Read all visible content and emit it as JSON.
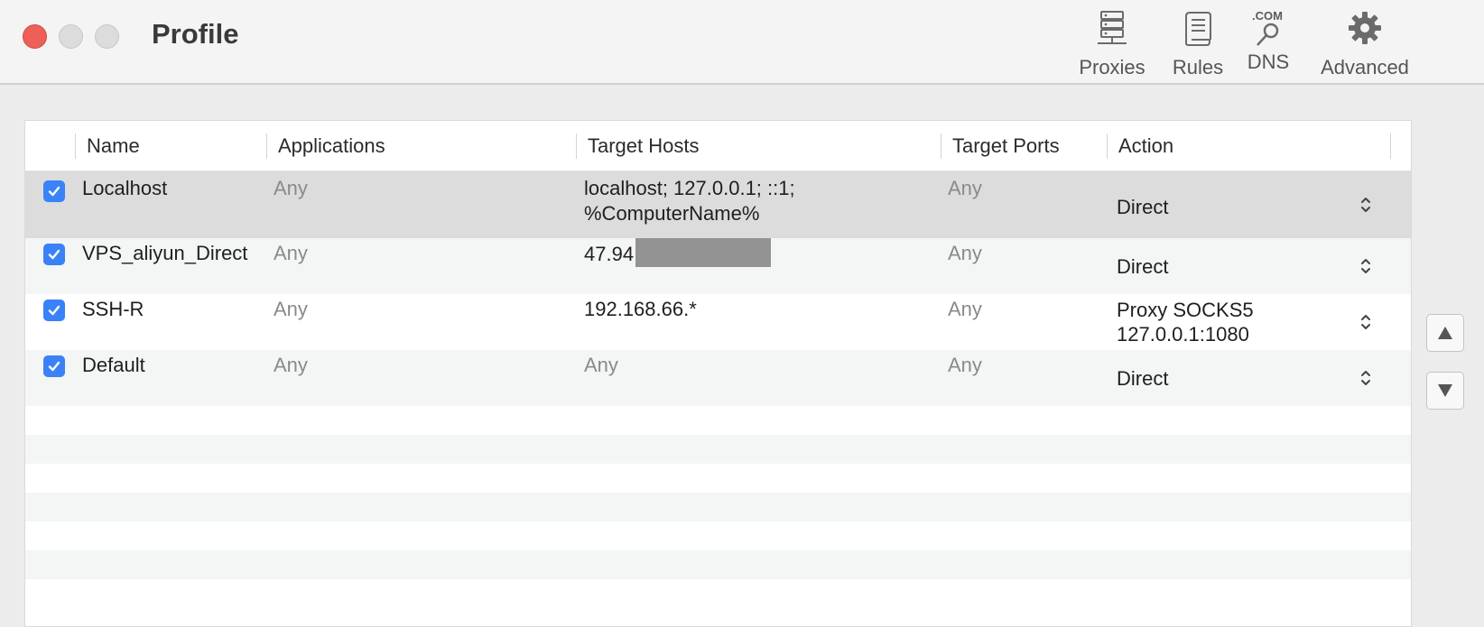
{
  "window": {
    "title": "Profile"
  },
  "toolbar": {
    "items": [
      {
        "label": "Proxies",
        "icon": "server-icon"
      },
      {
        "label": "Rules",
        "icon": "scroll-icon"
      },
      {
        "label": "DNS",
        "icon": "dns-search-icon",
        "badge": ".COM"
      },
      {
        "label": "Advanced",
        "icon": "gear-icon"
      }
    ]
  },
  "table": {
    "columns": [
      "Name",
      "Applications",
      "Target Hosts",
      "Target Ports",
      "Action"
    ],
    "rows": [
      {
        "enabled": true,
        "name": "Localhost",
        "apps": "Any",
        "hosts_line1": "localhost; 127.0.0.1; ::1;",
        "hosts_line2": "%ComputerName%",
        "ports": "Any",
        "action_line1": "Direct",
        "action_line2": ""
      },
      {
        "enabled": true,
        "name": "VPS_aliyun_Direct",
        "apps": "Any",
        "hosts_line1": "47.94",
        "hosts_line2": "",
        "ports": "Any",
        "action_line1": "Direct",
        "action_line2": ""
      },
      {
        "enabled": true,
        "name": "SSH-R",
        "apps": "Any",
        "hosts_line1": "192.168.66.*",
        "hosts_line2": "",
        "ports": "Any",
        "action_line1": "Proxy SOCKS5",
        "action_line2": "127.0.0.1:1080"
      },
      {
        "enabled": true,
        "name": "Default",
        "apps": "Any",
        "hosts_line1": "Any",
        "hosts_line2": "",
        "ports": "Any",
        "action_line1": "Direct",
        "action_line2": ""
      }
    ]
  },
  "colors": {
    "accent": "#3a82f7",
    "selected_row": "#dcdcdc",
    "close": "#ee5f57"
  },
  "side_buttons": {
    "up_icon": "move-up-icon",
    "down_icon": "move-down-icon"
  }
}
